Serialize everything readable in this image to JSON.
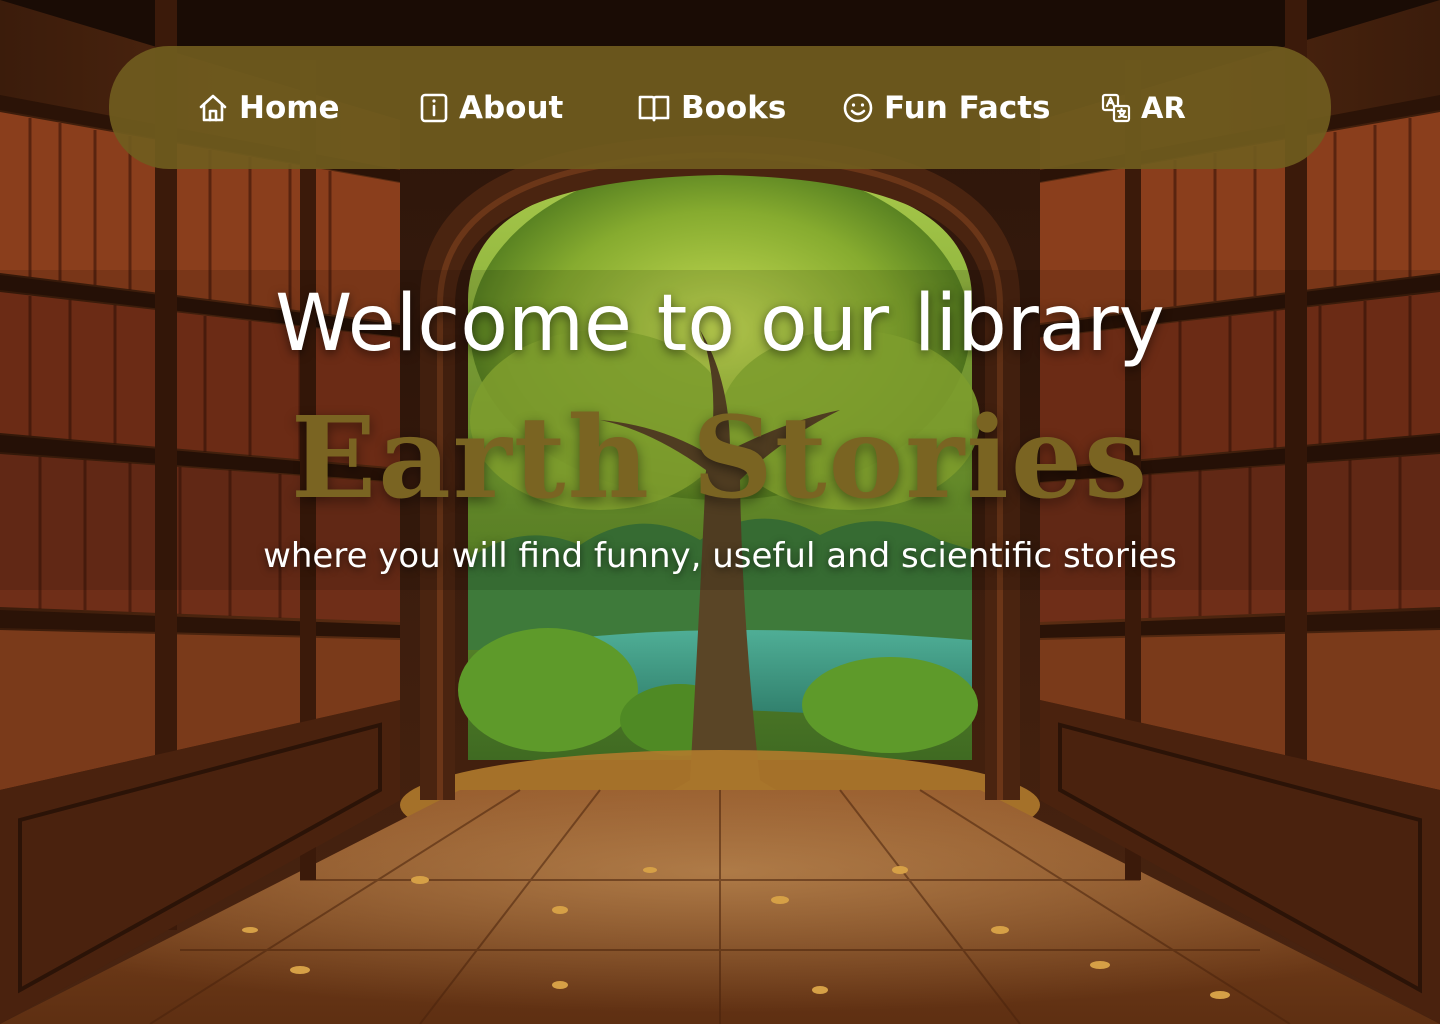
{
  "nav": {
    "items": [
      {
        "label": "Home",
        "icon": "home-icon"
      },
      {
        "label": "About",
        "icon": "info-icon"
      },
      {
        "label": "Books",
        "icon": "book-icon"
      },
      {
        "label": "Fun Facts",
        "icon": "smiley-icon"
      },
      {
        "label": "AR",
        "icon": "translate-icon"
      }
    ]
  },
  "hero": {
    "title": "Welcome to our library",
    "brand": "Earth Stories",
    "tagline": "where you will find funny, useful and scientific stories"
  },
  "colors": {
    "navbar_bg": "#705c1e",
    "brand_text": "#7a6422",
    "text_light": "#ffffff"
  }
}
